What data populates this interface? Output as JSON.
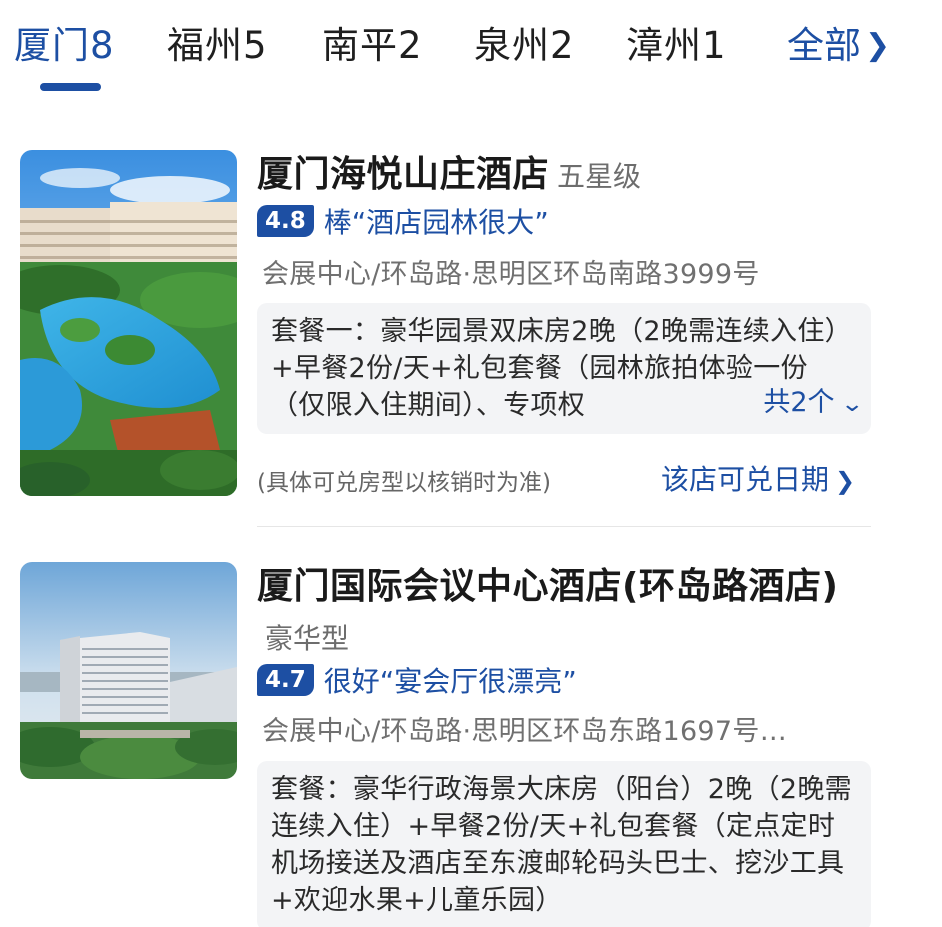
{
  "tabs": [
    {
      "label": "厦门8",
      "active": true
    },
    {
      "label": "福州5",
      "active": false
    },
    {
      "label": "南平2",
      "active": false
    },
    {
      "label": "泉州2",
      "active": false
    },
    {
      "label": "漳州1",
      "active": false
    }
  ],
  "tab_all": {
    "label": "全部",
    "icon": "chevron-right-icon"
  },
  "hotels": [
    {
      "name": "厦门海悦山庄酒店",
      "grade": "五星级",
      "rating": "4.8",
      "rating_text": "棒“酒店园林很大”",
      "address": "会展中心/环岛路·思明区环岛南路3999号",
      "package": "套餐一：豪华园景双床房2晚（2晚需连续入住）+早餐2份/天+礼包套餐（园林旅拍体验一份（仅限入住期间）、专项权",
      "package_more": "共2个",
      "note": "(具体可兑房型以核销时为准)",
      "date_link": "该店可兑日期"
    },
    {
      "name": "厦门国际会议中心酒店(环岛路酒店)",
      "grade": "豪华型",
      "rating": "4.7",
      "rating_text": "很好“宴会厅很漂亮”",
      "address": "会展中心/环岛路·思明区环岛东路1697号…",
      "package": "套餐：豪华行政海景大床房（阳台）2晚（2晚需连续入住）+早餐2份/天+礼包套餐（定点定时机场接送及酒店至东渡邮轮码头巴士、挖沙工具+欢迎水果+儿童乐园）"
    }
  ],
  "colors": {
    "accent": "#1d4fa3",
    "package_bg": "#f3f4f6"
  }
}
